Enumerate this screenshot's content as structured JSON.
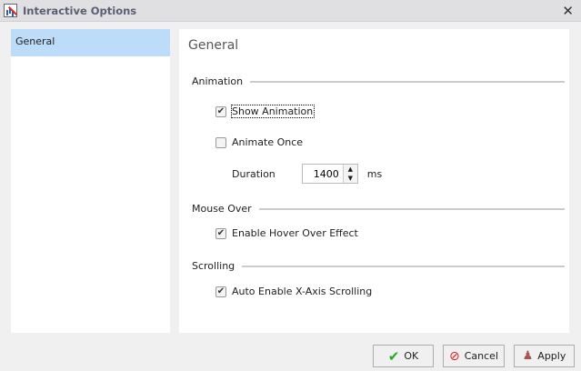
{
  "window": {
    "title": "Interactive Options",
    "close": "✕"
  },
  "sidebar": {
    "items": [
      {
        "label": "General"
      }
    ]
  },
  "main": {
    "heading": "General",
    "animation": {
      "label": "Animation",
      "show_animation": {
        "label": "Show Animation",
        "checked": true
      },
      "animate_once": {
        "label": "Animate Once",
        "checked": false
      },
      "duration": {
        "label": "Duration",
        "value": "1400",
        "unit": "ms"
      }
    },
    "mouse_over": {
      "label": "Mouse Over",
      "hover": {
        "label": "Enable Hover Over Effect",
        "checked": true
      }
    },
    "scrolling": {
      "label": "Scrolling",
      "auto": {
        "label": "Auto Enable X-Axis Scrolling",
        "checked": true
      }
    }
  },
  "buttons": {
    "ok": "OK",
    "cancel": "Cancel",
    "apply": "Apply"
  }
}
